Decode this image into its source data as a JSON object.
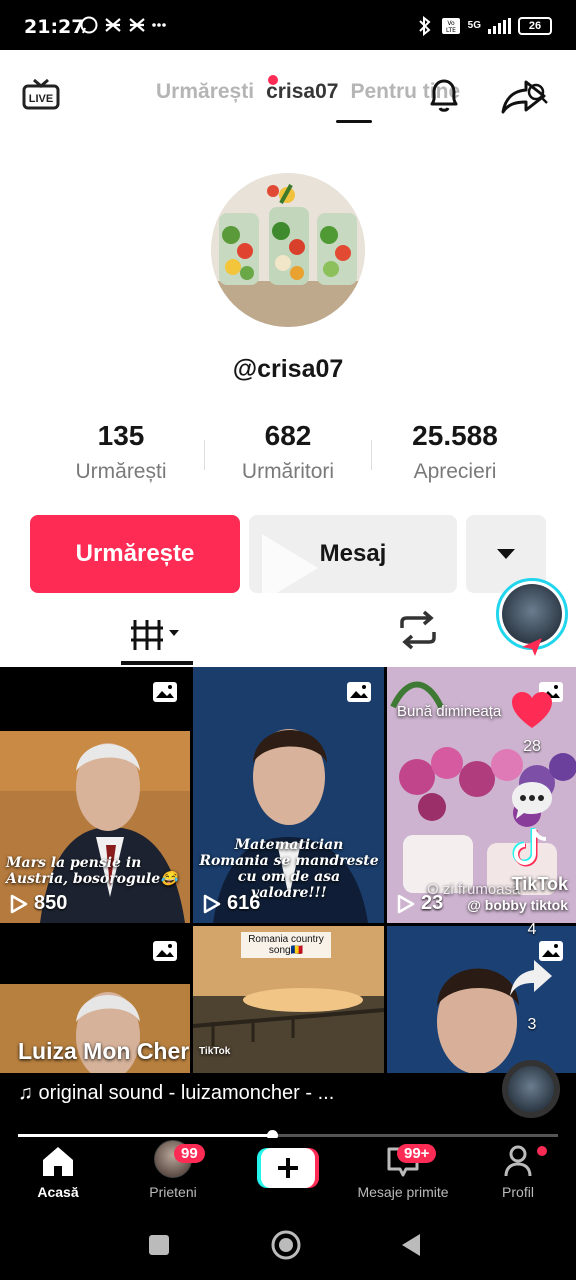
{
  "status_bar": {
    "time": "21:27",
    "network": "5G",
    "battery": "26"
  },
  "top_nav": {
    "tab_following": "Urmărești",
    "tab_for_you": "Pentru tine",
    "handle_overlay": "crisa07"
  },
  "profile": {
    "username": "@crisa07",
    "stats": [
      {
        "value": "135",
        "label": "Urmărești"
      },
      {
        "value": "682",
        "label": "Urmăritori"
      },
      {
        "value": "25.588",
        "label": "Aprecieri"
      }
    ],
    "follow_label": "Urmărește",
    "message_label": "Mesaj"
  },
  "videos": [
    {
      "caption": "Mars la pensie in Austria, bosorogule😂",
      "views": "850"
    },
    {
      "caption": "Matematician Romania se mandreste cu om de asa valoare!!!",
      "views": "616"
    },
    {
      "caption": "Bună dimineața",
      "caption2": "O zi frumoasă",
      "views": "23"
    },
    {
      "caption": ""
    },
    {
      "caption": "Romania country song🇷🇴"
    },
    {
      "caption": ""
    }
  ],
  "overlay": {
    "creator_name": "Luiza Mon Cher",
    "sound": "♫ original sound - luizamoncher - ...",
    "watermark": "TikTok",
    "watermark_handle": "@ bobby tiktok",
    "tiktok_label": "TikTok",
    "progress": 0.47
  },
  "rail": {
    "likes": "28",
    "comments": "4",
    "shares": "3"
  },
  "tabbar": {
    "home": "Acasă",
    "friends": "Prieteni",
    "friends_badge": "99",
    "inbox": "Mesaje primite",
    "inbox_badge": "99+",
    "profile": "Profil"
  },
  "colors": {
    "accent": "#fe2c55",
    "cyan": "#20d5ec"
  }
}
